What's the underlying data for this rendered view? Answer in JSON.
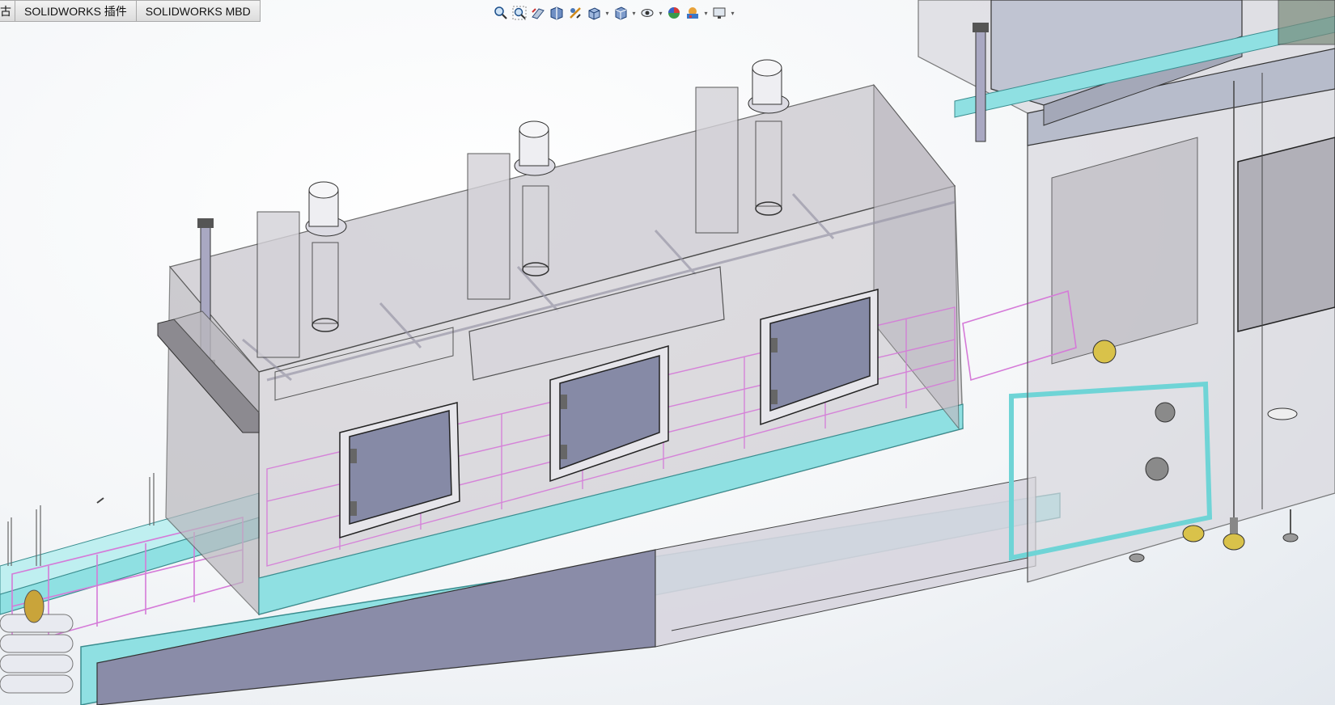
{
  "tabs": [
    {
      "label": "古"
    },
    {
      "label": "SOLIDWORKS 插件"
    },
    {
      "label": "SOLIDWORKS MBD"
    }
  ],
  "heads_up_toolbar": [
    {
      "icon": "zoom-to-fit-icon"
    },
    {
      "icon": "zoom-to-area-icon"
    },
    {
      "icon": "previous-view-icon"
    },
    {
      "icon": "section-view-icon"
    },
    {
      "icon": "dynamic-annotation-views-icon"
    },
    {
      "icon": "view-orientation-icon",
      "dropdown": true
    },
    {
      "icon": "display-style-icon",
      "dropdown": true
    },
    {
      "icon": "hide-show-items-icon",
      "dropdown": true
    },
    {
      "icon": "edit-appearance-icon"
    },
    {
      "icon": "apply-scene-icon",
      "dropdown": true
    },
    {
      "icon": "view-settings-icon",
      "dropdown": true
    }
  ],
  "colors": {
    "frame_cyan": "#6fd4d6",
    "basket_magenta": "#d57ad8",
    "door_panel": "#868aa6",
    "glass": "#c9c6cc",
    "base_panel": "#8a8ca8",
    "roof": "#b7bccb"
  }
}
